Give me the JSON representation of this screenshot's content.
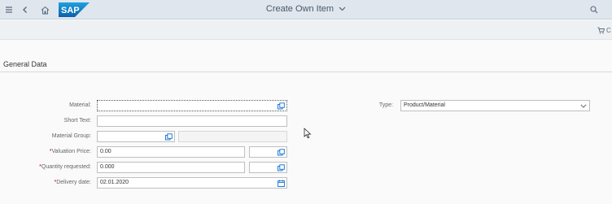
{
  "shell": {
    "title": "Create Own Item",
    "logo_text": "SAP",
    "icons": [
      "menu-icon",
      "back-icon",
      "home-icon",
      "search-icon"
    ]
  },
  "toolbar": {
    "cart_label": "C"
  },
  "form": {
    "section_title": "General Data",
    "material": {
      "label": "Material:",
      "value": ""
    },
    "short_text": {
      "label": "Short Text:",
      "value": ""
    },
    "material_group": {
      "label": "Material Group:",
      "value": "",
      "description": ""
    },
    "valuation_price": {
      "label": "Valuation Price:",
      "required": "*",
      "value": "0.00",
      "currency": ""
    },
    "quantity_requested": {
      "label": "Quantity requested:",
      "required": "*",
      "value": "0.000",
      "unit": ""
    },
    "delivery_date": {
      "label": "Delivery date:",
      "required": "*",
      "value": "02.01.2020"
    },
    "type": {
      "label": "Type:",
      "value": "Product/Material"
    }
  },
  "colors": {
    "shell_bg": "#dfe6ee",
    "sap_blue": "#1873b4",
    "required": "#bb0000"
  }
}
